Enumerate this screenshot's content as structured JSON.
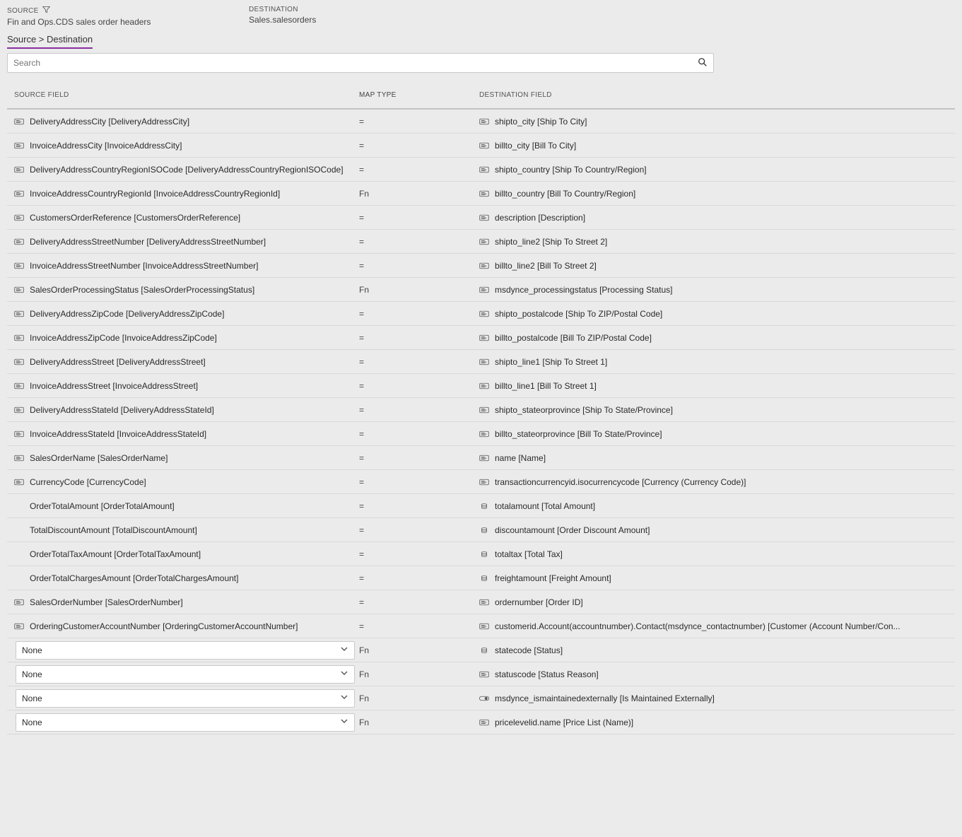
{
  "meta": {
    "sourceLabel": "SOURCE",
    "sourceValue": "Fin and Ops.CDS sales order headers",
    "destLabel": "DESTINATION",
    "destValue": "Sales.salesorders"
  },
  "tabs": {
    "label": "Source > Destination"
  },
  "search": {
    "placeholder": "Search"
  },
  "columns": {
    "source": "SOURCE FIELD",
    "mapType": "MAP TYPE",
    "destination": "DESTINATION FIELD"
  },
  "selectDefault": "None",
  "rows": [
    {
      "srcIcon": "field",
      "src": "DeliveryAddressCity [DeliveryAddressCity]",
      "type": "=",
      "destIcon": "field",
      "dest": "shipto_city [Ship To City]"
    },
    {
      "srcIcon": "field",
      "src": "InvoiceAddressCity [InvoiceAddressCity]",
      "type": "=",
      "destIcon": "field",
      "dest": "billto_city [Bill To City]"
    },
    {
      "srcIcon": "field",
      "src": "DeliveryAddressCountryRegionISOCode [DeliveryAddressCountryRegionISOCode]",
      "type": "=",
      "destIcon": "field",
      "dest": "shipto_country [Ship To Country/Region]"
    },
    {
      "srcIcon": "field",
      "src": "InvoiceAddressCountryRegionId [InvoiceAddressCountryRegionId]",
      "type": "Fn",
      "destIcon": "field",
      "dest": "billto_country [Bill To Country/Region]"
    },
    {
      "srcIcon": "field",
      "src": "CustomersOrderReference [CustomersOrderReference]",
      "type": "=",
      "destIcon": "field",
      "dest": "description [Description]"
    },
    {
      "srcIcon": "field",
      "src": "DeliveryAddressStreetNumber [DeliveryAddressStreetNumber]",
      "type": "=",
      "destIcon": "field",
      "dest": "shipto_line2 [Ship To Street 2]"
    },
    {
      "srcIcon": "field",
      "src": "InvoiceAddressStreetNumber [InvoiceAddressStreetNumber]",
      "type": "=",
      "destIcon": "field",
      "dest": "billto_line2 [Bill To Street 2]"
    },
    {
      "srcIcon": "field",
      "src": "SalesOrderProcessingStatus [SalesOrderProcessingStatus]",
      "type": "Fn",
      "destIcon": "field",
      "dest": "msdynce_processingstatus [Processing Status]"
    },
    {
      "srcIcon": "field",
      "src": "DeliveryAddressZipCode [DeliveryAddressZipCode]",
      "type": "=",
      "destIcon": "field",
      "dest": "shipto_postalcode [Ship To ZIP/Postal Code]"
    },
    {
      "srcIcon": "field",
      "src": "InvoiceAddressZipCode [InvoiceAddressZipCode]",
      "type": "=",
      "destIcon": "field",
      "dest": "billto_postalcode [Bill To ZIP/Postal Code]"
    },
    {
      "srcIcon": "field",
      "src": "DeliveryAddressStreet [DeliveryAddressStreet]",
      "type": "=",
      "destIcon": "field",
      "dest": "shipto_line1 [Ship To Street 1]"
    },
    {
      "srcIcon": "field",
      "src": "InvoiceAddressStreet [InvoiceAddressStreet]",
      "type": "=",
      "destIcon": "field",
      "dest": "billto_line1 [Bill To Street 1]"
    },
    {
      "srcIcon": "field",
      "src": "DeliveryAddressStateId [DeliveryAddressStateId]",
      "type": "=",
      "destIcon": "field",
      "dest": "shipto_stateorprovince [Ship To State/Province]"
    },
    {
      "srcIcon": "field",
      "src": "InvoiceAddressStateId [InvoiceAddressStateId]",
      "type": "=",
      "destIcon": "field",
      "dest": "billto_stateorprovince [Bill To State/Province]"
    },
    {
      "srcIcon": "field",
      "src": "SalesOrderName [SalesOrderName]",
      "type": "=",
      "destIcon": "field",
      "dest": "name [Name]"
    },
    {
      "srcIcon": "field",
      "src": "CurrencyCode [CurrencyCode]",
      "type": "=",
      "destIcon": "field",
      "dest": "transactioncurrencyid.isocurrencycode [Currency (Currency Code)]"
    },
    {
      "srcIcon": "none",
      "src": "OrderTotalAmount [OrderTotalAmount]",
      "type": "=",
      "destIcon": "money",
      "dest": "totalamount [Total Amount]"
    },
    {
      "srcIcon": "none",
      "src": "TotalDiscountAmount [TotalDiscountAmount]",
      "type": "=",
      "destIcon": "money",
      "dest": "discountamount [Order Discount Amount]"
    },
    {
      "srcIcon": "none",
      "src": "OrderTotalTaxAmount [OrderTotalTaxAmount]",
      "type": "=",
      "destIcon": "money",
      "dest": "totaltax [Total Tax]"
    },
    {
      "srcIcon": "none",
      "src": "OrderTotalChargesAmount [OrderTotalChargesAmount]",
      "type": "=",
      "destIcon": "money",
      "dest": "freightamount [Freight Amount]"
    },
    {
      "srcIcon": "field",
      "src": "SalesOrderNumber [SalesOrderNumber]",
      "type": "=",
      "destIcon": "field",
      "dest": "ordernumber [Order ID]"
    },
    {
      "srcIcon": "field",
      "src": "OrderingCustomerAccountNumber [OrderingCustomerAccountNumber]",
      "type": "=",
      "destIcon": "field",
      "dest": "customerid.Account(accountnumber).Contact(msdynce_contactnumber) [Customer (Account Number/Con..."
    },
    {
      "srcIcon": "select",
      "src": "None",
      "type": "Fn",
      "destIcon": "money",
      "dest": "statecode [Status]"
    },
    {
      "srcIcon": "select",
      "src": "None",
      "type": "Fn",
      "destIcon": "field",
      "dest": "statuscode [Status Reason]"
    },
    {
      "srcIcon": "select",
      "src": "None",
      "type": "Fn",
      "destIcon": "toggle",
      "dest": "msdynce_ismaintainedexternally [Is Maintained Externally]"
    },
    {
      "srcIcon": "select",
      "src": "None",
      "type": "Fn",
      "destIcon": "field",
      "dest": "pricelevelid.name [Price List (Name)]"
    }
  ]
}
